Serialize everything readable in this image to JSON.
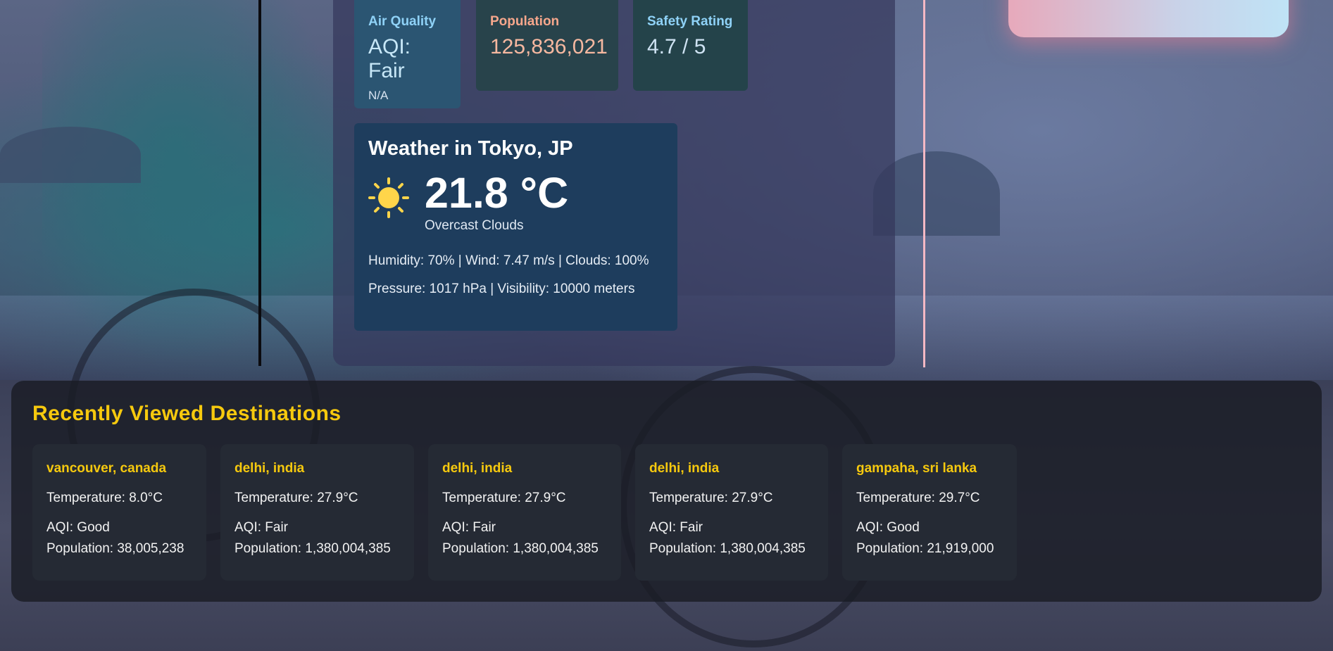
{
  "stats": {
    "air_quality": {
      "label": "Air Quality",
      "value": "AQI: Fair",
      "sub": "N/A",
      "icon": "leaf-icon"
    },
    "population": {
      "label": "Population",
      "value": "125,836,021",
      "icon": "people-icon"
    },
    "safety": {
      "label": "Safety Rating",
      "value": "4.7 / 5",
      "icon": "shield-icon"
    }
  },
  "weather": {
    "title": "Weather in Tokyo, JP",
    "icon": "sun-icon",
    "temperature": "21.8 °C",
    "description": "Overcast Clouds",
    "details_line1": "Humidity: 70% | Wind: 7.47 m/s | Clouds: 100%",
    "details_line2": "Pressure: 1017 hPa | Visibility: 10000 meters"
  },
  "recent": {
    "title": "Recently Viewed Destinations",
    "items": [
      {
        "name": "vancouver, canada",
        "temp": "Temperature: 8.0°C",
        "aqi": "AQI: Good",
        "population": "Population: 38,005,238"
      },
      {
        "name": "delhi, india",
        "temp": "Temperature: 27.9°C",
        "aqi": "AQI: Fair",
        "population": "Population: 1,380,004,385"
      },
      {
        "name": "delhi, india",
        "temp": "Temperature: 27.9°C",
        "aqi": "AQI: Fair",
        "population": "Population: 1,380,004,385"
      },
      {
        "name": "delhi, india",
        "temp": "Temperature: 27.9°C",
        "aqi": "AQI: Fair",
        "population": "Population: 1,380,004,385"
      },
      {
        "name": "gampaha, sri lanka",
        "temp": "Temperature: 29.7°C",
        "aqi": "AQI: Good",
        "population": "Population: 21,919,000"
      }
    ]
  },
  "colors": {
    "accent_yellow": "#f6c90e",
    "weather_card": "#1e3d5d",
    "aqi_card": "#2b5572"
  }
}
